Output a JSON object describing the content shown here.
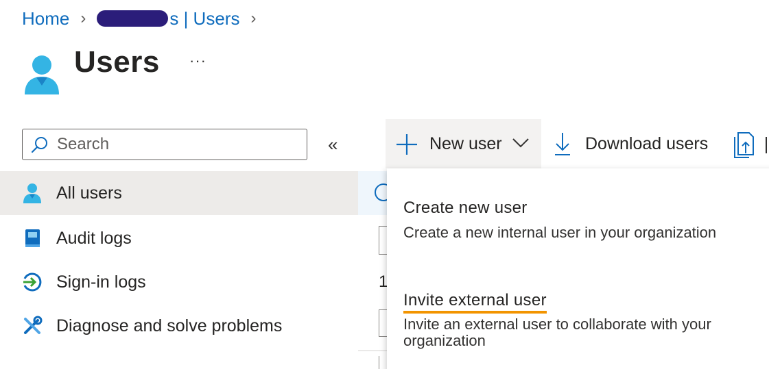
{
  "breadcrumb": {
    "home": "Home",
    "tenant_suffix": "s | Users"
  },
  "page": {
    "title": "Users",
    "more": "···"
  },
  "search": {
    "placeholder": "Search"
  },
  "sidebar": {
    "collapse": "«",
    "items": [
      {
        "label": "All users",
        "icon": "user-icon",
        "selected": true
      },
      {
        "label": "Audit logs",
        "icon": "book-icon",
        "selected": false
      },
      {
        "label": "Sign-in logs",
        "icon": "sign-in-icon",
        "selected": false
      },
      {
        "label": "Diagnose and solve problems",
        "icon": "wrench-icon",
        "selected": false
      }
    ]
  },
  "toolbar": {
    "new_user": "New user",
    "download_users": "Download users"
  },
  "background": {
    "row_number": "1"
  },
  "new_user_menu": {
    "items": [
      {
        "title": "Create new user",
        "description": "Create a new internal user in your organization"
      },
      {
        "title": "Invite external user",
        "description": "Invite an external user to collaborate with your organization"
      }
    ]
  },
  "colors": {
    "link": "#0f6cbd",
    "selected_bg": "#edebe9",
    "highlight_underline": "#f29400",
    "redaction": "#2b1d7a"
  }
}
